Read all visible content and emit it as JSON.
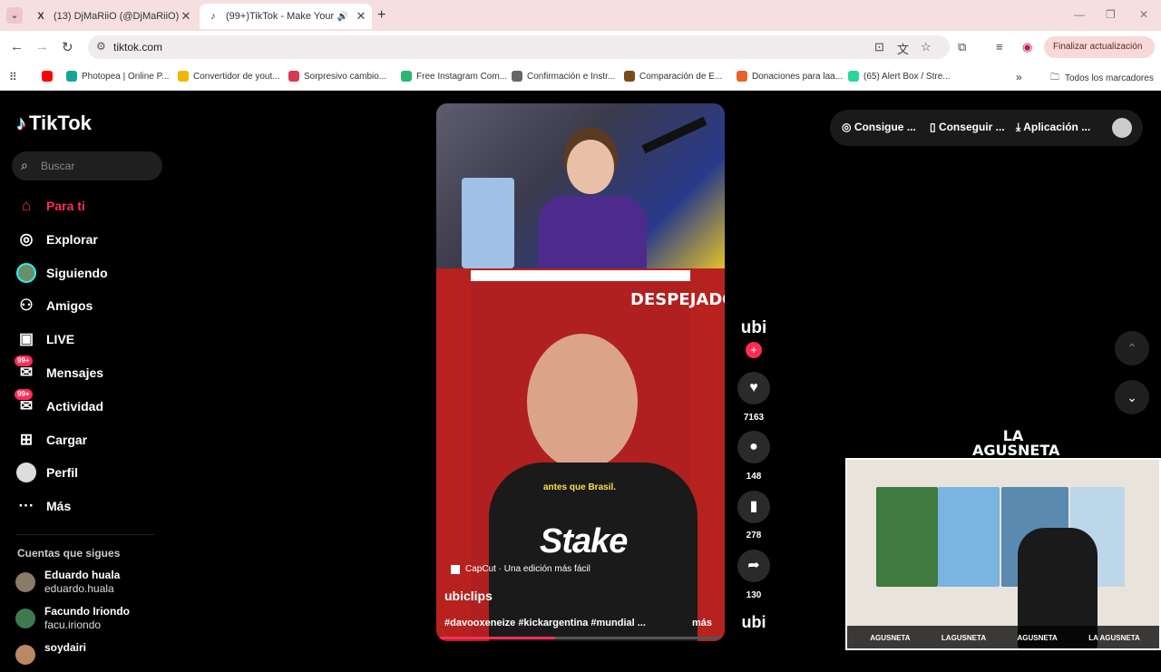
{
  "browser": {
    "tabs": [
      {
        "icon": "X",
        "title": "(13) DjMaRiiO (@DjMaRiiO) / X",
        "close": "✕"
      },
      {
        "icon": "♪",
        "title": "(99+)TikTok - Make Your Day",
        "close": "✕"
      }
    ],
    "new_tab": "+",
    "url": "tiktok.com",
    "update_label": "Finalizar actualización",
    "bookmarks": [
      {
        "label": "",
        "color": "#ff0000"
      },
      {
        "label": "Photopea | Online P...",
        "color": "#18a497"
      },
      {
        "label": "Convertidor de yout...",
        "color": "#f2b705"
      },
      {
        "label": "Sorpresivo cambio...",
        "color": "#d83a52"
      },
      {
        "label": "Free Instagram Com...",
        "color": "#2bb673"
      },
      {
        "label": "Confirmación e Instr...",
        "color": "#666666"
      },
      {
        "label": "Comparación de E...",
        "color": "#7a4a1a"
      },
      {
        "label": "Donaciones para laa...",
        "color": "#e8612c"
      },
      {
        "label": "(65) Alert Box / Stre...",
        "color": "#2bd5a0"
      }
    ],
    "bookmarks_more": "»",
    "all_bookmarks": "Todos los marcadores"
  },
  "tiktok": {
    "logo": "TikTok",
    "search_placeholder": "Buscar",
    "nav": [
      {
        "label": "Para ti",
        "icon": "home-icon",
        "active": true
      },
      {
        "label": "Explorar",
        "icon": "compass-icon"
      },
      {
        "label": "Siguiendo",
        "icon": "following-avatar"
      },
      {
        "label": "Amigos",
        "icon": "friends-icon"
      },
      {
        "label": "LIVE",
        "icon": "live-icon"
      },
      {
        "label": "Mensajes",
        "icon": "messages-icon",
        "badge": "99+"
      },
      {
        "label": "Actividad",
        "icon": "activity-icon",
        "badge": "99+"
      },
      {
        "label": "Cargar",
        "icon": "upload-icon"
      },
      {
        "label": "Perfil",
        "icon": "profile-avatar"
      },
      {
        "label": "Más",
        "icon": "more-icon"
      }
    ],
    "following_header": "Cuentas que sigues",
    "following": [
      {
        "name": "Eduardo huala",
        "user": "eduardo.huala"
      },
      {
        "name": "Facundo Iriondo",
        "user": "facu.iriondo"
      },
      {
        "name": "soydairi",
        "user": ""
      }
    ],
    "top_actions": [
      "Consigue ...",
      "Conseguir ...",
      "Aplicación ..."
    ],
    "video": {
      "overlay_title": "DESPEJADOS",
      "subtitle": "antes que Brasil.",
      "sponsor": "Stake",
      "capcut": "CapCut · Una edición más fácil",
      "author": "ubiclips",
      "description": "#davooxeneize #kickargentina #mundial ...",
      "more": "más",
      "progress_pct": 41
    },
    "actions": {
      "avatar_text": "ubi",
      "likes": "7163",
      "comments": "148",
      "saves": "278",
      "shares": "130",
      "music_text": "ubi"
    },
    "webcam": {
      "logo": "LA AGUSNETA",
      "socials": [
        "AGUSNETA",
        "LAGUSNETA",
        "AGUSNETA",
        "LA AGUSNETA"
      ]
    }
  }
}
